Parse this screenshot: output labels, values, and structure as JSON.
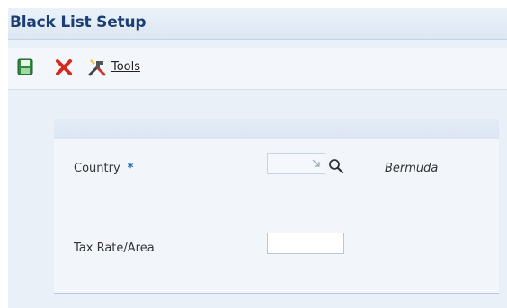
{
  "window": {
    "title": "Black List Setup"
  },
  "toolbar": {
    "save_icon": "save-icon",
    "cancel_icon": "close-icon",
    "tools_icon": "tools-icon",
    "tools_label": "Tools"
  },
  "form": {
    "country": {
      "label": "Country",
      "required_marker": "*",
      "value": "",
      "description": "Bermuda"
    },
    "tax_rate_area": {
      "label": "Tax Rate/Area",
      "value": ""
    }
  },
  "colors": {
    "title": "#1c3f73",
    "required": "#1a66b8",
    "cancel": "#d52b1e",
    "save": "#2f8a3d"
  }
}
